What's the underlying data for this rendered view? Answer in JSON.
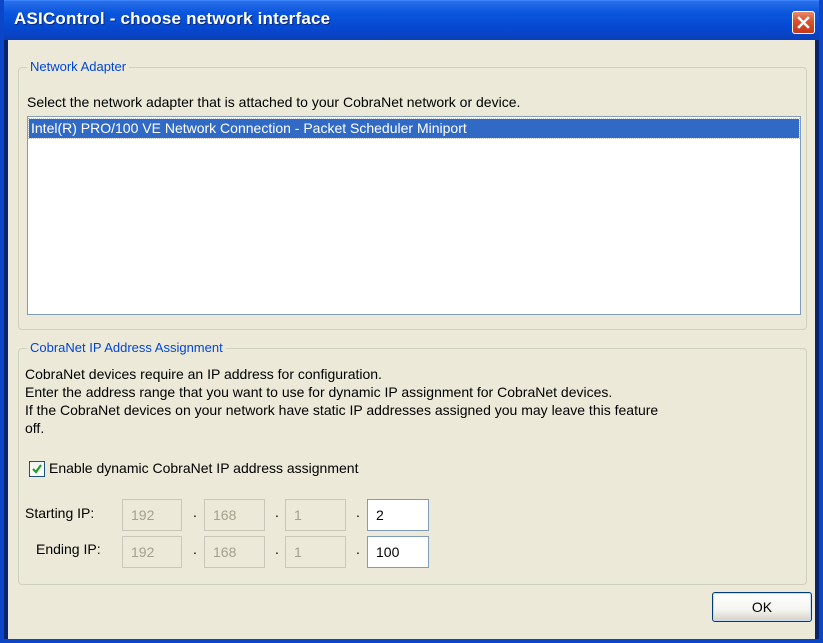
{
  "window": {
    "title": "ASIControl - choose network interface",
    "close_icon": "close-icon"
  },
  "network_adapter": {
    "legend": "Network Adapter",
    "instruction": "Select the network adapter that is attached to your CobraNet network or device.",
    "adapters": [
      "Intel(R) PRO/100 VE Network Connection - Packet Scheduler Miniport"
    ],
    "selected_index": 0
  },
  "ip_assignment": {
    "legend": "CobraNet IP Address Assignment",
    "desc_line1": "CobraNet devices require an IP address for configuration.",
    "desc_line2": "Enter the address range that you want to use for dynamic IP assignment for CobraNet devices.",
    "desc_line3": "If the CobraNet devices on your network have static IP addresses assigned you may leave this feature",
    "desc_line4": "off.",
    "enable_label": "Enable dynamic CobraNet IP address assignment",
    "enable_checked": true,
    "starting_ip": {
      "label": "Starting IP:",
      "octets": [
        "192",
        "168",
        "1",
        "2"
      ]
    },
    "ending_ip": {
      "label": "Ending IP:",
      "octets": [
        "192",
        "168",
        "1",
        "100"
      ]
    },
    "separator": "."
  },
  "buttons": {
    "ok_label": "OK"
  },
  "colors": {
    "titlebar": "#0a56de",
    "selection": "#316ac5",
    "group_legend": "#0046d5",
    "dialog_bg": "#ece9d8"
  }
}
